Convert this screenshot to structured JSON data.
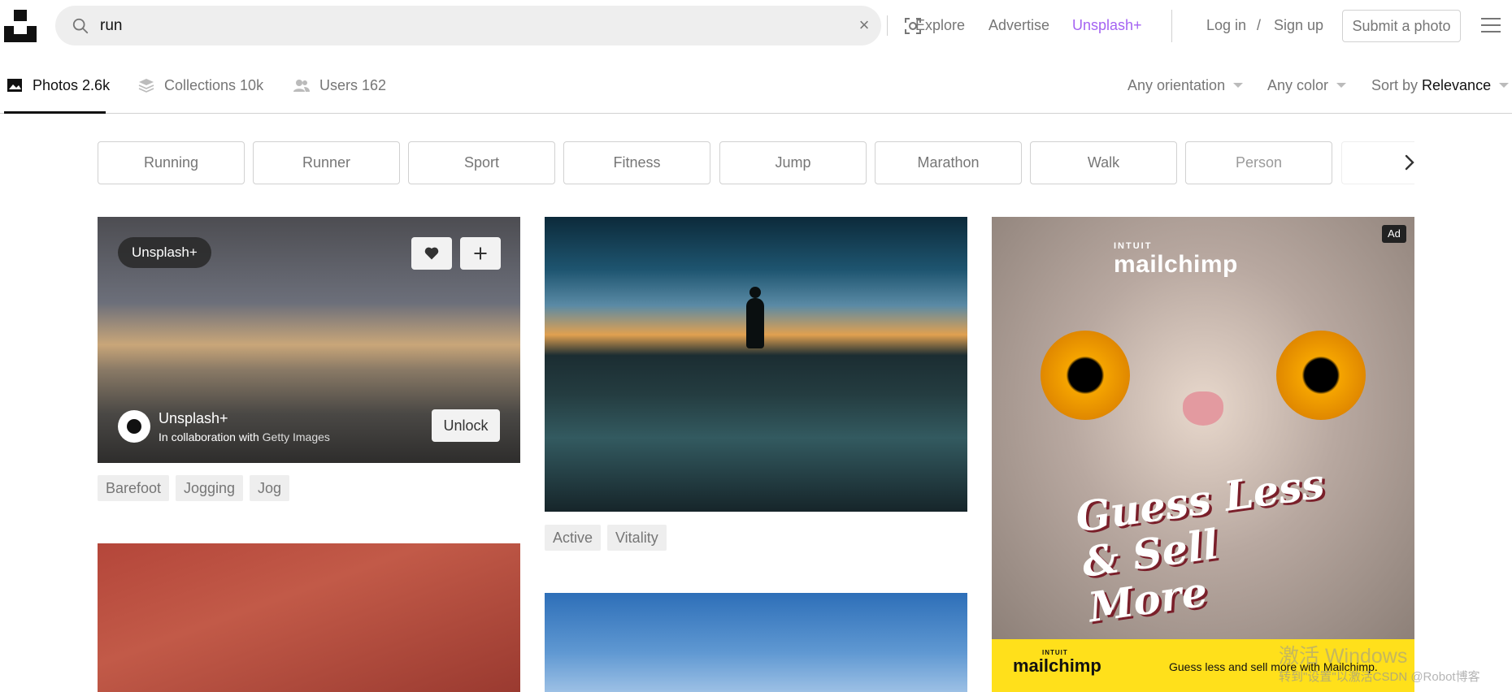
{
  "header": {
    "search_value": "run",
    "nav": [
      "Explore",
      "Advertise",
      "Unsplash+"
    ],
    "login": "Log in",
    "slash": "/",
    "signup": "Sign up",
    "submit_photo": "Submit a photo"
  },
  "tabs": {
    "photos": "Photos 2.6k",
    "collections": "Collections 10k",
    "users": "Users 162"
  },
  "filters": {
    "orientation": "Any orientation",
    "color": "Any color",
    "sort_prefix": "Sort by ",
    "sort_value": "Relevance"
  },
  "chips": [
    "Running",
    "Runner",
    "Sport",
    "Fitness",
    "Jump",
    "Marathon",
    "Walk",
    "Person"
  ],
  "photo1": {
    "badge": "Unsplash+",
    "credit_name": "Unsplash+",
    "credit_sub_prefix": "In collaboration with ",
    "credit_sub_brand": "Getty Images",
    "unlock": "Unlock",
    "tags": [
      "Barefoot",
      "Jogging",
      "Jog"
    ]
  },
  "photo2": {
    "tags": [
      "Active",
      "Vitality"
    ]
  },
  "ad": {
    "badge": "Ad",
    "brand_small": "INTUIT",
    "brand": "mailchimp",
    "headline": "Guess Less & Sell More",
    "bar_brand_small": "INTUIT",
    "bar_brand": "mailchimp",
    "tagline": "Guess less and sell more with Mailchimp."
  },
  "watermark": {
    "line1": "激活 Windows",
    "line2": "转到\"设置\"以激活CSDN @Robot博客"
  }
}
